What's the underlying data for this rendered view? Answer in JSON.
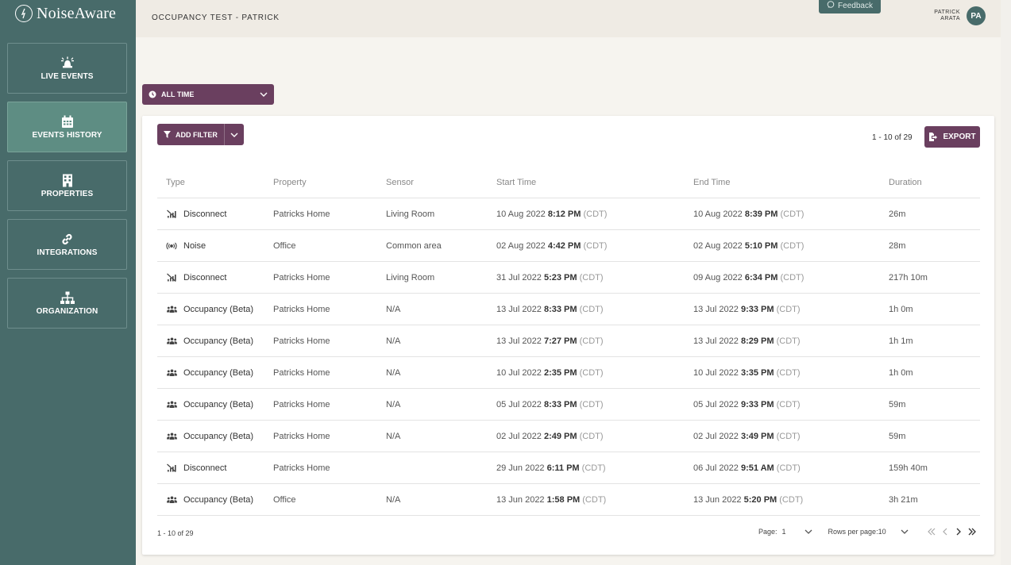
{
  "brand": {
    "name": "NoiseAware"
  },
  "sidebar": {
    "items": [
      {
        "label": "LIVE EVENTS",
        "icon": "siren-icon",
        "active": false
      },
      {
        "label": "EVENTS HISTORY",
        "icon": "calendar-icon",
        "active": true
      },
      {
        "label": "PROPERTIES",
        "icon": "building-icon",
        "active": false
      },
      {
        "label": "INTEGRATIONS",
        "icon": "link-icon",
        "active": false
      },
      {
        "label": "ORGANIZATION",
        "icon": "org-chart-icon",
        "active": false
      }
    ]
  },
  "header": {
    "title": "OCCUPANCY TEST - PATRICK",
    "feedback_label": "Feedback",
    "user_first": "PATRICK",
    "user_last": "ARATA",
    "user_initials": "PA"
  },
  "time_filter": {
    "selected": "ALL TIME"
  },
  "toolbar": {
    "add_filter_label": "ADD FILTER",
    "range_label": "1 - 10 of 29",
    "export_label": "EXPORT"
  },
  "table": {
    "columns": [
      "Type",
      "Property",
      "Sensor",
      "Start Time",
      "End Time",
      "Duration"
    ],
    "rows": [
      {
        "type": "Disconnect",
        "icon": "disconnect-icon",
        "property": "Patricks Home",
        "sensor": "Living Room",
        "start_date": "10 Aug 2022",
        "start_time": "8:12 PM",
        "start_tz": "(CDT)",
        "end_date": "10 Aug 2022",
        "end_time": "8:39 PM",
        "end_tz": "(CDT)",
        "duration": "26m"
      },
      {
        "type": "Noise",
        "icon": "noise-icon",
        "property": "Office",
        "sensor": "Common area",
        "start_date": "02 Aug 2022",
        "start_time": "4:42 PM",
        "start_tz": "(CDT)",
        "end_date": "02 Aug 2022",
        "end_time": "5:10 PM",
        "end_tz": "(CDT)",
        "duration": "28m"
      },
      {
        "type": "Disconnect",
        "icon": "disconnect-icon",
        "property": "Patricks Home",
        "sensor": "Living Room",
        "start_date": "31 Jul 2022",
        "start_time": "5:23 PM",
        "start_tz": "(CDT)",
        "end_date": "09 Aug 2022",
        "end_time": "6:34 PM",
        "end_tz": "(CDT)",
        "duration": "217h 10m"
      },
      {
        "type": "Occupancy (Beta)",
        "icon": "occupancy-icon",
        "property": "Patricks Home",
        "sensor": "N/A",
        "start_date": "13 Jul 2022",
        "start_time": "8:33 PM",
        "start_tz": "(CDT)",
        "end_date": "13 Jul 2022",
        "end_time": "9:33 PM",
        "end_tz": "(CDT)",
        "duration": "1h 0m"
      },
      {
        "type": "Occupancy (Beta)",
        "icon": "occupancy-icon",
        "property": "Patricks Home",
        "sensor": "N/A",
        "start_date": "13 Jul 2022",
        "start_time": "7:27 PM",
        "start_tz": "(CDT)",
        "end_date": "13 Jul 2022",
        "end_time": "8:29 PM",
        "end_tz": "(CDT)",
        "duration": "1h 1m"
      },
      {
        "type": "Occupancy (Beta)",
        "icon": "occupancy-icon",
        "property": "Patricks Home",
        "sensor": "N/A",
        "start_date": "10 Jul 2022",
        "start_time": "2:35 PM",
        "start_tz": "(CDT)",
        "end_date": "10 Jul 2022",
        "end_time": "3:35 PM",
        "end_tz": "(CDT)",
        "duration": "1h 0m"
      },
      {
        "type": "Occupancy (Beta)",
        "icon": "occupancy-icon",
        "property": "Patricks Home",
        "sensor": "N/A",
        "start_date": "05 Jul 2022",
        "start_time": "8:33 PM",
        "start_tz": "(CDT)",
        "end_date": "05 Jul 2022",
        "end_time": "9:33 PM",
        "end_tz": "(CDT)",
        "duration": "59m"
      },
      {
        "type": "Occupancy (Beta)",
        "icon": "occupancy-icon",
        "property": "Patricks Home",
        "sensor": "N/A",
        "start_date": "02 Jul 2022",
        "start_time": "2:49 PM",
        "start_tz": "(CDT)",
        "end_date": "02 Jul 2022",
        "end_time": "3:49 PM",
        "end_tz": "(CDT)",
        "duration": "59m"
      },
      {
        "type": "Disconnect",
        "icon": "disconnect-icon",
        "property": "Patricks Home",
        "sensor": "",
        "start_date": "29 Jun 2022",
        "start_time": "6:11 PM",
        "start_tz": "(CDT)",
        "end_date": "06 Jul 2022",
        "end_time": "9:51 AM",
        "end_tz": "(CDT)",
        "duration": "159h 40m"
      },
      {
        "type": "Occupancy (Beta)",
        "icon": "occupancy-icon",
        "property": "Office",
        "sensor": "N/A",
        "start_date": "13 Jun 2022",
        "start_time": "1:58 PM",
        "start_tz": "(CDT)",
        "end_date": "13 Jun 2022",
        "end_time": "5:20 PM",
        "end_tz": "(CDT)",
        "duration": "3h 21m"
      }
    ]
  },
  "pagination": {
    "range_label": "1 - 10 of 29",
    "page_label": "Page:",
    "page_value": "1",
    "rows_label": "Rows per page:",
    "rows_value": "10"
  },
  "colors": {
    "sidebar": "#486b6a",
    "sidebar_active": "#5e8d83",
    "accent": "#6a3f5f",
    "background": "#f6f4ef"
  }
}
